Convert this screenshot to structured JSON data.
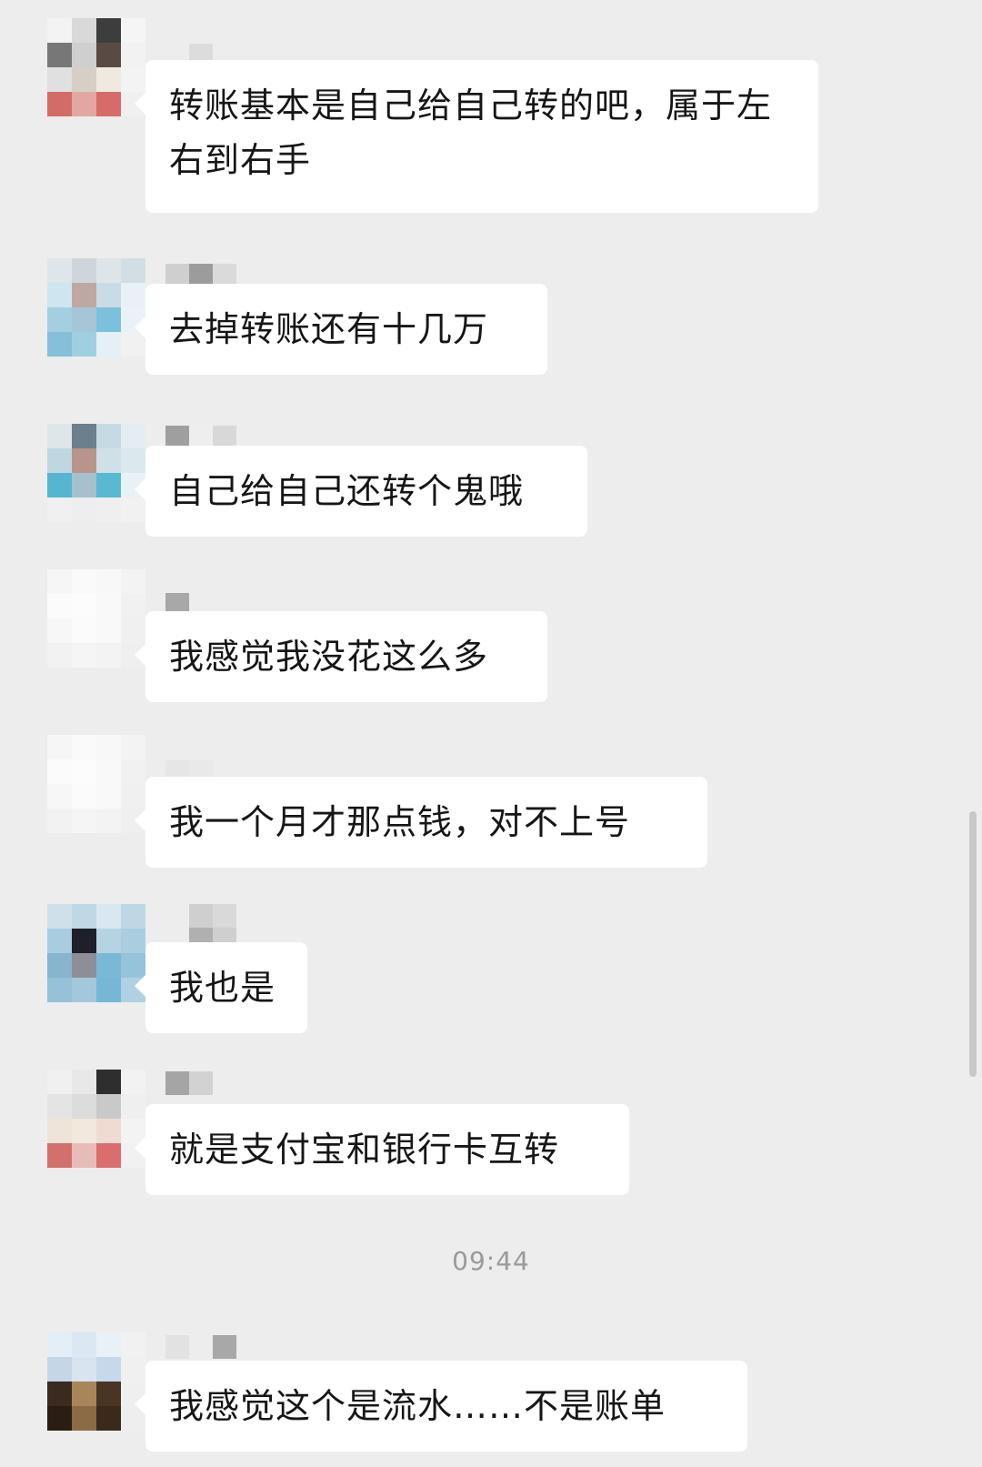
{
  "messages": [
    {
      "text": "转账基本是自己给自己转的吧，属于左右到右手"
    },
    {
      "text": "去掉转账还有十几万"
    },
    {
      "text": "自己给自己还转个鬼哦"
    },
    {
      "text": "我感觉我没花这么多"
    },
    {
      "text": "我一个月才那点钱，对不上号"
    },
    {
      "text": "我也是"
    },
    {
      "text": "就是支付宝和银行卡互转"
    },
    {
      "text": "我感觉这个是流水……不是账单"
    }
  ],
  "timestamp": "09:44",
  "colors": {
    "background": "#ededed",
    "bubble": "#ffffff",
    "text": "#161616",
    "timestamp": "#9a9a9a"
  },
  "icons": [
    "avatar-image",
    "blurred-nickname"
  ]
}
